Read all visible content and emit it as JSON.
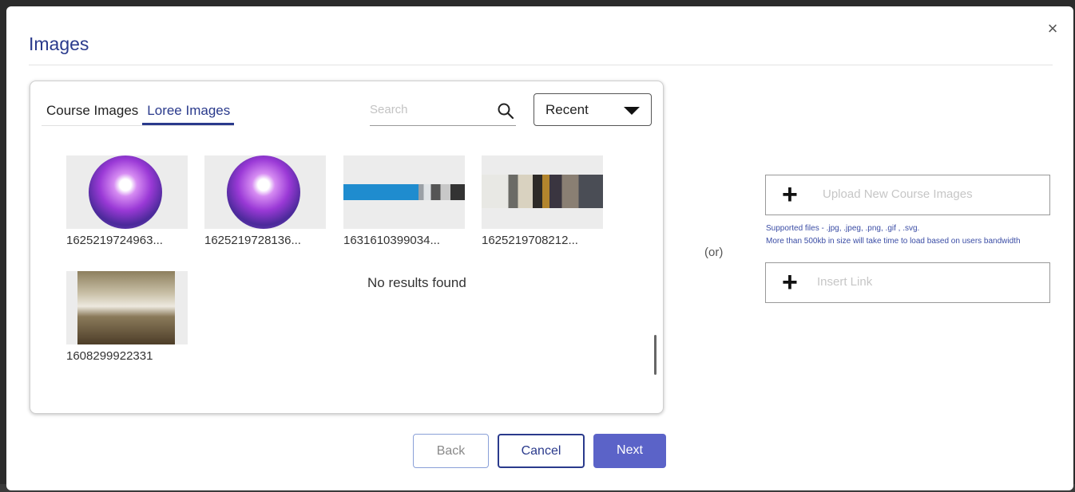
{
  "dialog": {
    "title": "Images",
    "close_label": "×"
  },
  "tabs": [
    {
      "label": "Course Images",
      "active": false
    },
    {
      "label": "Loree Images",
      "active": true
    }
  ],
  "search": {
    "placeholder": "Search",
    "value": ""
  },
  "sort": {
    "selected": "Recent"
  },
  "images": [
    {
      "name": "1625219724963...",
      "thumb": "circle"
    },
    {
      "name": "1625219728136...",
      "thumb": "circle"
    },
    {
      "name": "1631610399034...",
      "thumb": "banner"
    },
    {
      "name": "1625219708212...",
      "thumb": "books"
    },
    {
      "name": "1608299922331",
      "thumb": "church"
    }
  ],
  "no_results_text": "No results found",
  "or_text": "(or)",
  "upload": {
    "label": "Upload New Course Images",
    "supported": "Supported files - .jpg, .jpeg, .png, .gif , .svg.",
    "note": "More than 500kb in size will take time to load based on users bandwidth"
  },
  "insert_link": {
    "label": "Insert Link"
  },
  "actions": {
    "back": "Back",
    "cancel": "Cancel",
    "next": "Next"
  }
}
